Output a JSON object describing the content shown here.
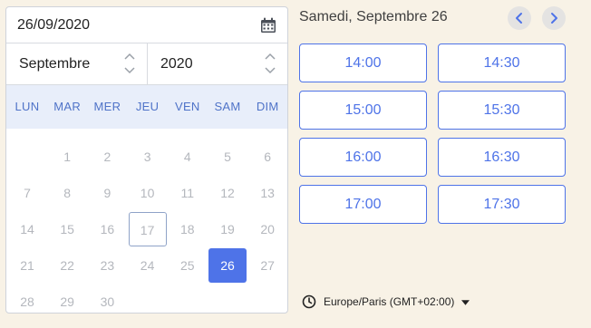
{
  "date_input": {
    "value": "26/09/2020"
  },
  "month_select": {
    "value": "Septembre"
  },
  "year_select": {
    "value": "2020"
  },
  "weekdays": [
    "LUN",
    "MAR",
    "MER",
    "JEU",
    "VEN",
    "SAM",
    "DIM"
  ],
  "days": [
    {
      "n": "1",
      "col": 1,
      "row": 0
    },
    {
      "n": "2",
      "col": 2,
      "row": 0
    },
    {
      "n": "3",
      "col": 3,
      "row": 0
    },
    {
      "n": "4",
      "col": 4,
      "row": 0
    },
    {
      "n": "5",
      "col": 5,
      "row": 0
    },
    {
      "n": "6",
      "col": 6,
      "row": 0
    },
    {
      "n": "7",
      "col": 0,
      "row": 1
    },
    {
      "n": "8",
      "col": 1,
      "row": 1
    },
    {
      "n": "9",
      "col": 2,
      "row": 1
    },
    {
      "n": "10",
      "col": 3,
      "row": 1
    },
    {
      "n": "11",
      "col": 4,
      "row": 1
    },
    {
      "n": "12",
      "col": 5,
      "row": 1
    },
    {
      "n": "13",
      "col": 6,
      "row": 1
    },
    {
      "n": "14",
      "col": 0,
      "row": 2
    },
    {
      "n": "15",
      "col": 1,
      "row": 2
    },
    {
      "n": "16",
      "col": 2,
      "row": 2
    },
    {
      "n": "17",
      "col": 3,
      "row": 2,
      "state": "today"
    },
    {
      "n": "18",
      "col": 4,
      "row": 2
    },
    {
      "n": "19",
      "col": 5,
      "row": 2
    },
    {
      "n": "20",
      "col": 6,
      "row": 2
    },
    {
      "n": "21",
      "col": 0,
      "row": 3
    },
    {
      "n": "22",
      "col": 1,
      "row": 3
    },
    {
      "n": "23",
      "col": 2,
      "row": 3
    },
    {
      "n": "24",
      "col": 3,
      "row": 3
    },
    {
      "n": "25",
      "col": 4,
      "row": 3
    },
    {
      "n": "26",
      "col": 5,
      "row": 3,
      "state": "selected"
    },
    {
      "n": "27",
      "col": 6,
      "row": 3
    },
    {
      "n": "28",
      "col": 0,
      "row": 4
    },
    {
      "n": "29",
      "col": 1,
      "row": 4
    },
    {
      "n": "30",
      "col": 2,
      "row": 4
    }
  ],
  "day_title": "Samedi, Septembre 26",
  "time_slots": [
    "14:00",
    "14:30",
    "15:00",
    "15:30",
    "16:00",
    "16:30",
    "17:00",
    "17:30"
  ],
  "timezone": {
    "label": "Europe/Paris (GMT+02:00)"
  },
  "colors": {
    "accent": "#4e73e8",
    "weekday_header_bg": "#e8eefa",
    "weekday_text": "#4f73c8",
    "disabled_day": "#b4b7bd",
    "page_bg": "#f8f2e6"
  },
  "icons": {
    "date_input": "calendar-icon",
    "prev": "chevron-left-icon",
    "next": "chevron-right-icon",
    "timezone": "clock-icon",
    "timezone_caret": "caret-down-icon"
  }
}
